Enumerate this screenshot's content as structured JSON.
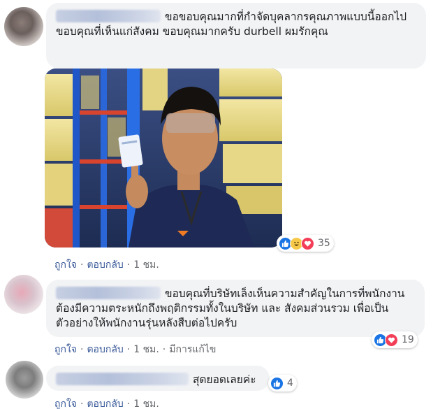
{
  "comments": [
    {
      "text": "ขอขอบคุณมากที่กำจัดบุคลากรคุณภาพแบบนี้ออกไปขอบคุณที่เห็นแก่สังคม ขอบคุณมากครับ durbell ผมรักคุณ",
      "reaction_count": "35",
      "reactions": [
        "like",
        "haha",
        "love"
      ],
      "actions": {
        "like": "ถูกใจ",
        "reply": "ตอบกลับ",
        "time": "1 ชม."
      }
    },
    {
      "text": "ขอบคุณที่บริษัทเล็งเห็นความสำคัญในการที่พนักงานต้องมีความตระหนักถึงพฤติกรรมทั้งในบริษัท และ สังคมส่วนรวม เพื่อเป็นตัวอย่างให้พนักงานรุ่นหลังสืบต่อไปครับ",
      "reaction_count": "19",
      "reactions": [
        "like",
        "love"
      ],
      "actions": {
        "like": "ถูกใจ",
        "reply": "ตอบกลับ",
        "time": "1 ชม.",
        "edited": "มีการแก้ไข"
      }
    },
    {
      "text": "สุดยอดเลยค่ะ",
      "reaction_count": "4",
      "reactions": [
        "like"
      ],
      "actions": {
        "like": "ถูกใจ",
        "reply": "ตอบกลับ",
        "time": "1 ชม."
      }
    }
  ],
  "colors": {
    "bubble": "#f2f3f5",
    "link": "#385898",
    "meta": "#65676b",
    "like": "#1b74e4",
    "love": "#f33e58",
    "haha": "#f7c94a"
  },
  "icons": [
    "like-reaction-icon",
    "haha-reaction-icon",
    "love-reaction-icon"
  ]
}
